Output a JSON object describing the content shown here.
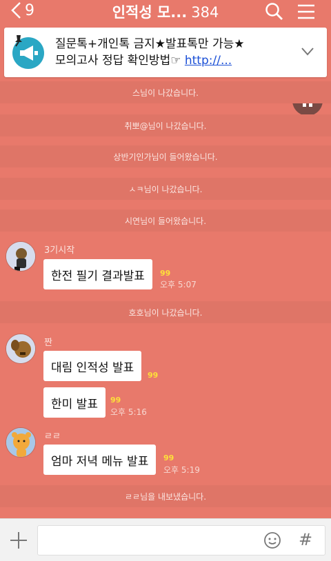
{
  "header": {
    "back_count": "9",
    "title": "인적성 모...",
    "member_count": "384"
  },
  "notice": {
    "line1": "질문톡+개인톡 금지★발표톡만 가능★",
    "line2_text": "모의고사 정답 확인방법☞ ",
    "link_text": "http://..."
  },
  "system_messages": [
    "스님이 나갔습니다.",
    "취뽀@님이 나갔습니다.",
    "상반기인가님이 들어왔습니다.",
    "ㅅㅋ님이 나갔습니다.",
    "시연님이 들어왔습니다.",
    "호호님이 나갔습니다.",
    "ㄹㄹ님을 내보냈습니다."
  ],
  "messages": [
    {
      "sender": "3기시작",
      "bubbles": [
        {
          "text": "한전 필기 결과발표",
          "unread": "99",
          "time": "오후 5:07"
        }
      ]
    },
    {
      "sender": "짠",
      "bubbles": [
        {
          "text": "대림 인적성 발표",
          "unread": "99",
          "time": ""
        },
        {
          "text": "한미 발표",
          "unread": "99",
          "time": "오후 5:16"
        }
      ]
    },
    {
      "sender": "ㄹㄹ",
      "bubbles": [
        {
          "text": "엄마 저녁 메뉴 발표",
          "unread": "99",
          "time": "오후 5:19"
        }
      ]
    }
  ],
  "input_bar": {
    "placeholder": "",
    "hash_label": "#"
  },
  "colors": {
    "background": "#e8796b",
    "system_row": "#df7567",
    "unread": "#fde03a",
    "link": "#1a4fd6"
  }
}
